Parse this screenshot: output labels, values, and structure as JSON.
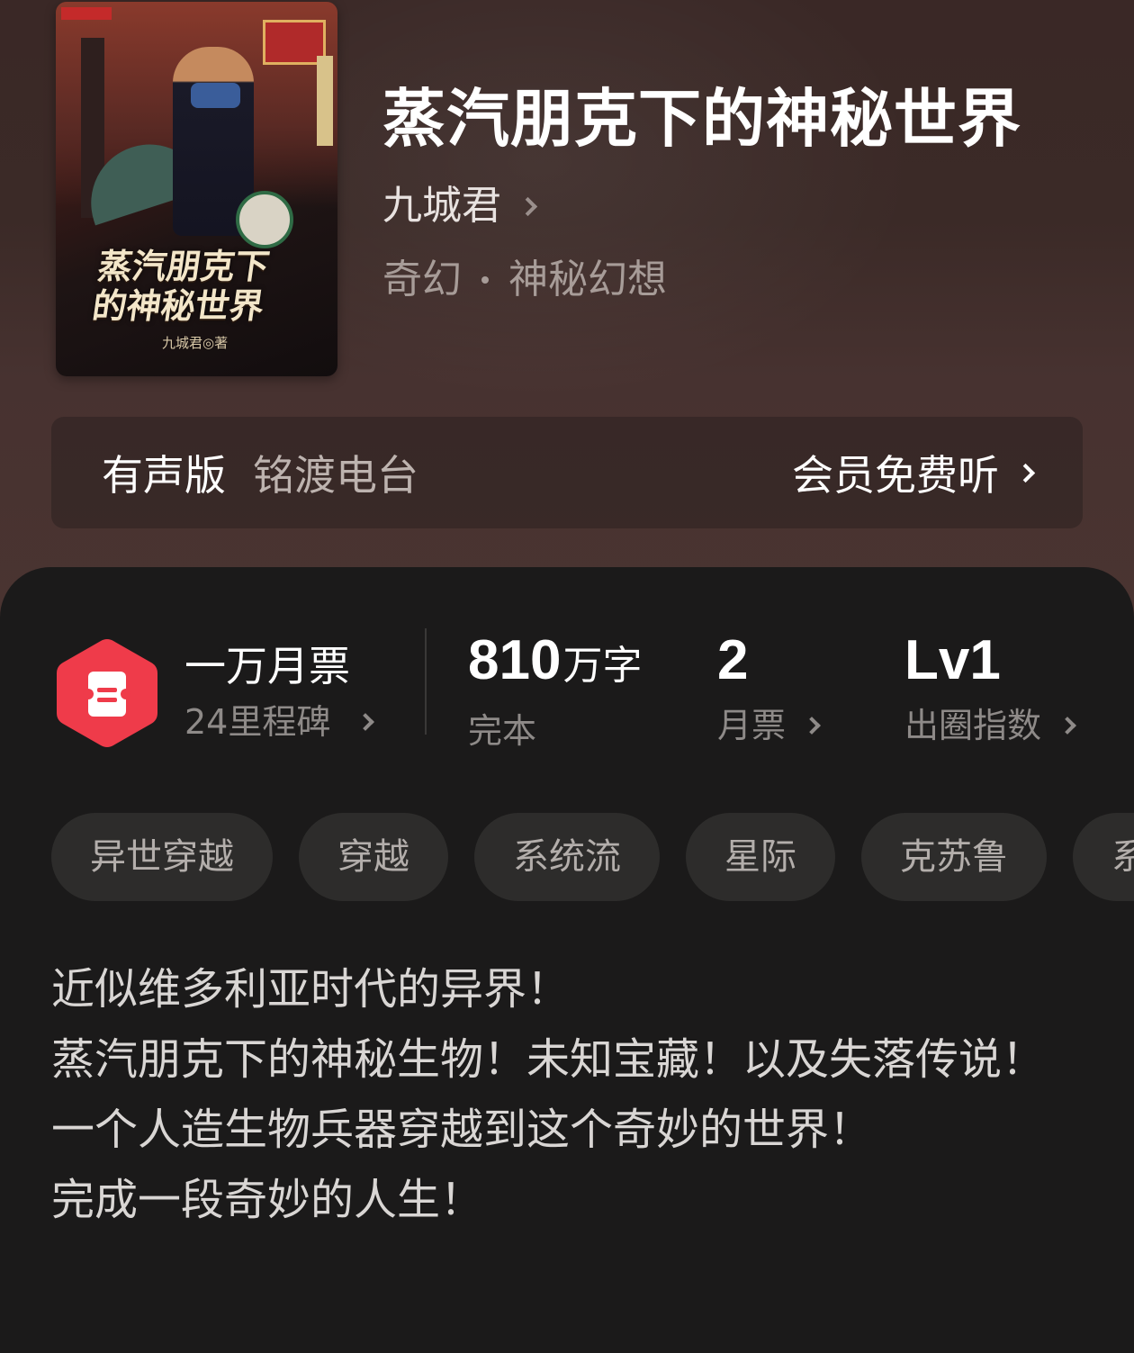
{
  "book": {
    "title": "蒸汽朋克下的神秘世界",
    "author": "九城君",
    "category": "奇幻",
    "subcategory": "神秘幻想",
    "cover": {
      "title_line1": "蒸汽朋克下",
      "title_line2": "的神秘世界",
      "author_line": "九城君◎著"
    }
  },
  "audio": {
    "label": "有声版",
    "station": "铭渡电台",
    "action": "会员免费听"
  },
  "stats": {
    "ticket": {
      "title": "一万月票",
      "subtitle": "24里程碑",
      "icon": "ticket-hexagon-icon",
      "color": "#ef3b4a"
    },
    "words": {
      "value": "810",
      "unit": "万字",
      "label": "完本"
    },
    "monthly": {
      "value": "2",
      "label": "月票"
    },
    "popularity": {
      "value": "Lv1",
      "label": "出圈指数"
    }
  },
  "tags": [
    "异世穿越",
    "穿越",
    "系统流",
    "星际",
    "克苏鲁",
    "系"
  ],
  "description": [
    "近似维多利亚时代的异界！",
    "蒸汽朋克下的神秘生物！未知宝藏！以及失落传说！",
    "一个人造生物兵器穿越到这个奇妙的世界！",
    "完成一段奇妙的人生！"
  ]
}
